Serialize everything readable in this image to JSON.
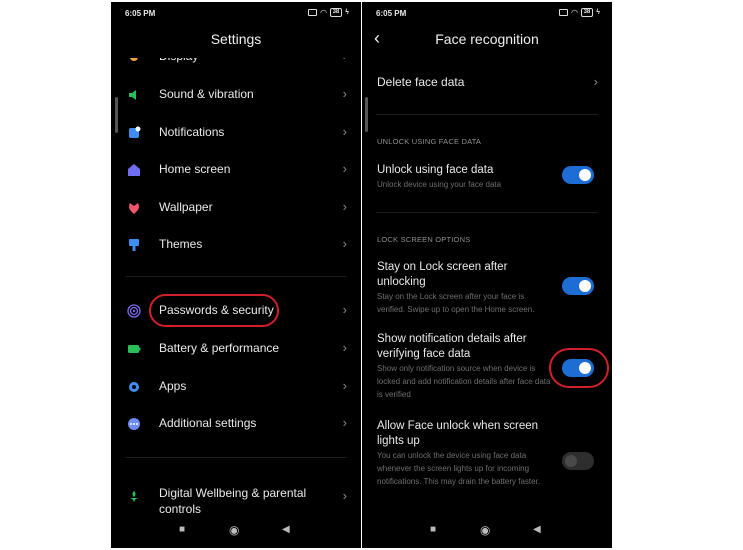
{
  "status": {
    "time": "6:05 PM",
    "battery": "38"
  },
  "settings": {
    "title": "Settings",
    "items": [
      {
        "label": "Display",
        "icon": "display-icon",
        "color": "#f2a33a"
      },
      {
        "label": "Sound & vibration",
        "icon": "speaker-icon",
        "color": "#2bbf5a"
      },
      {
        "label": "Notifications",
        "icon": "notification-icon",
        "color": "#3d8df2"
      },
      {
        "label": "Home screen",
        "icon": "home-icon",
        "color": "#6f6df2"
      },
      {
        "label": "Wallpaper",
        "icon": "wallpaper-icon",
        "color": "#f0566b"
      },
      {
        "label": "Themes",
        "icon": "themes-icon",
        "color": "#3d8df2"
      },
      {
        "label": "Passwords & security",
        "icon": "fingerprint-icon",
        "color": "#7b6cf0"
      },
      {
        "label": "Battery & performance",
        "icon": "battery-icon",
        "color": "#2bbf5a"
      },
      {
        "label": "Apps",
        "icon": "gear-icon",
        "color": "#3d8df2"
      },
      {
        "label": "Additional settings",
        "icon": "more-icon",
        "color": "#6f8cf2"
      },
      {
        "label": "Digital Wellbeing & parental controls",
        "icon": "wellbeing-icon",
        "color": "#2bbf5a"
      }
    ]
  },
  "face": {
    "title": "Face recognition",
    "delete_label": "Delete face data",
    "section1": "UNLOCK USING FACE DATA",
    "unlock_title": "Unlock using face data",
    "unlock_sub": "Unlock device using your face data",
    "section2": "LOCK SCREEN OPTIONS",
    "stay_title": "Stay on Lock screen after unlocking",
    "stay_sub": "Stay on the Lock screen after your face is verified. Swipe up to open the Home screen.",
    "notif_title": "Show notification details after verifying face data",
    "notif_sub": "Show only notification source when device is locked and add notification details after face data is verified",
    "allow_title": "Allow Face unlock when screen lights up",
    "allow_sub": "You can unlock the device using face data whenever the screen lights up for incoming notifications. This may drain the battery faster.",
    "toggles": {
      "unlock": true,
      "stay": true,
      "notif": true,
      "allow": false
    }
  },
  "nav": {
    "recents": "■",
    "home": "◉",
    "back": "◀"
  },
  "colors": {
    "highlight": "#d2202a",
    "toggle_on": "#1e6dd5"
  }
}
